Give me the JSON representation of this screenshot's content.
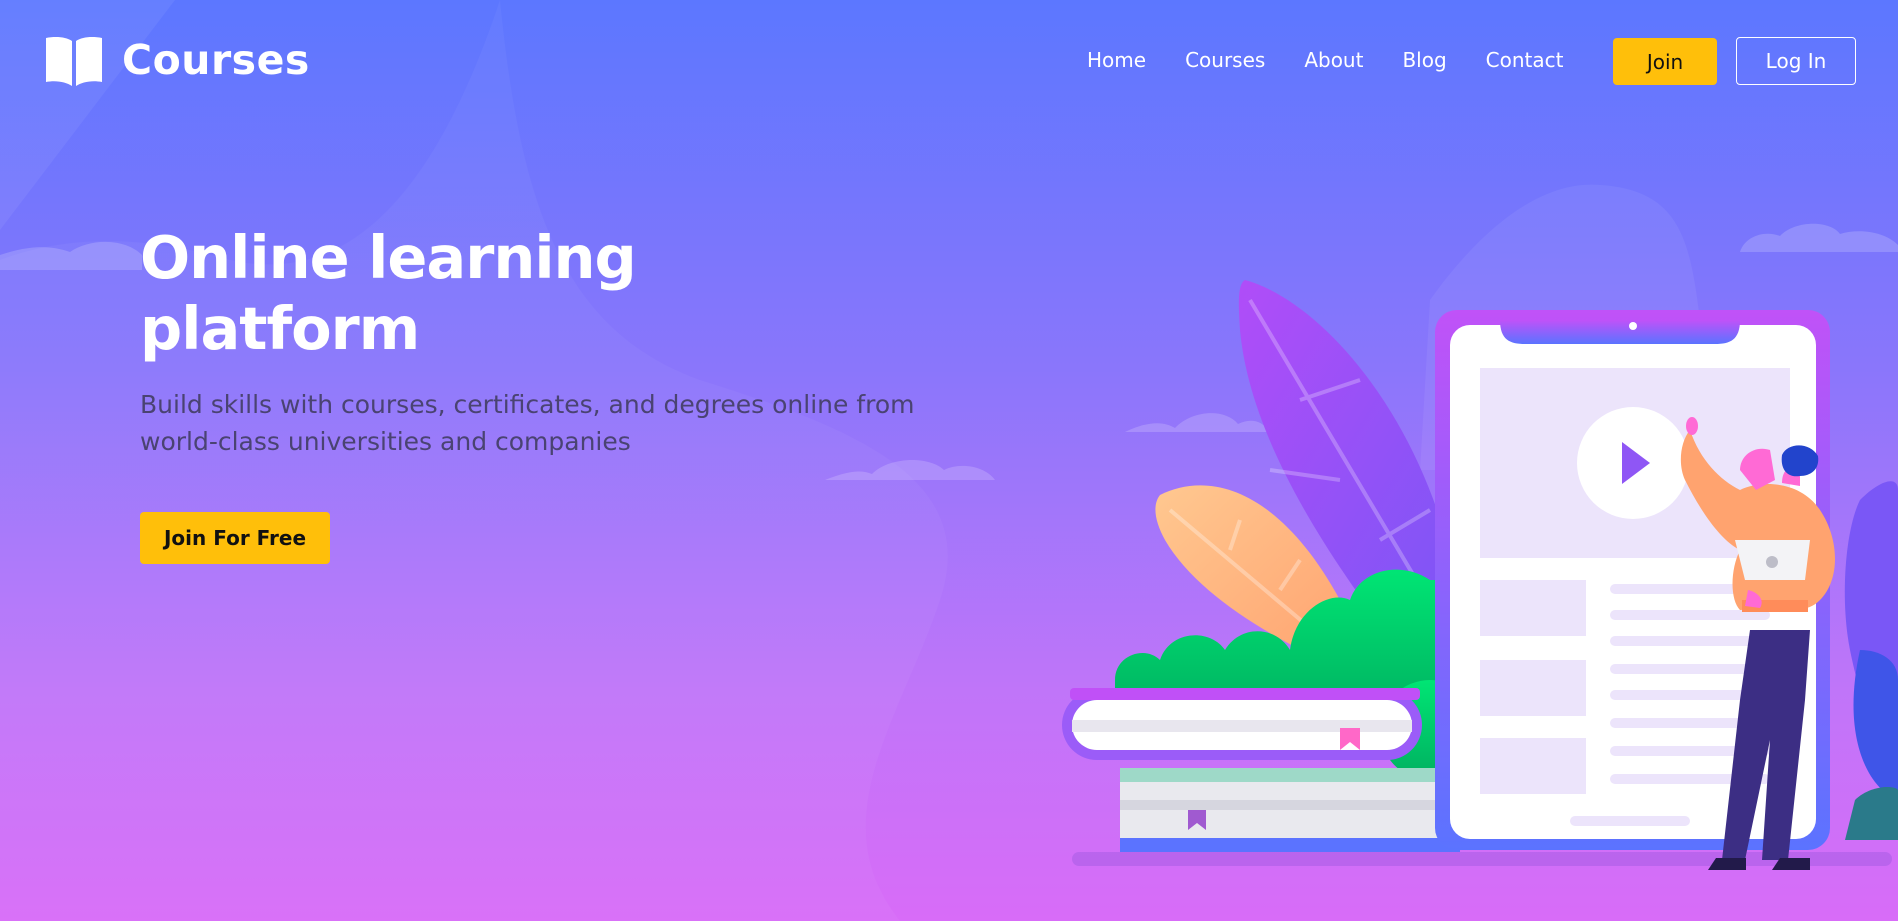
{
  "brand": {
    "name": "Courses",
    "logo_icon": "open-book-icon"
  },
  "nav": {
    "items": [
      {
        "label": "Home"
      },
      {
        "label": "Courses"
      },
      {
        "label": "About"
      },
      {
        "label": "Blog"
      },
      {
        "label": "Contact"
      }
    ],
    "join_label": "Join",
    "login_label": "Log In"
  },
  "hero": {
    "title_line1": "Online learning",
    "title_line2": "platform",
    "subtitle_line1": "Build skills with courses, certificates, and degrees online from",
    "subtitle_line2": "world-class universities and companies",
    "cta_label": "Join For Free"
  },
  "colors": {
    "accent": "#ffbf0a",
    "bg_top": "#5c77ff",
    "bg_bottom": "#d86cf8",
    "text_light": "#ffffff",
    "text_muted": "#4a4372"
  },
  "illustration": {
    "play_icon": "play-icon",
    "bookmark_icon": "bookmark-icon"
  }
}
